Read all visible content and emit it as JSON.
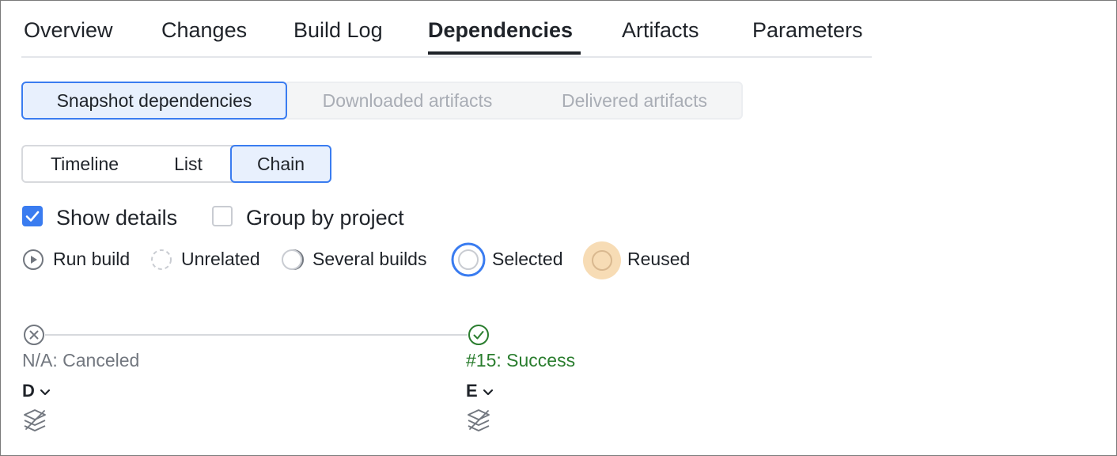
{
  "tabs": [
    {
      "label": "Overview"
    },
    {
      "label": "Changes"
    },
    {
      "label": "Build Log"
    },
    {
      "label": "Dependencies",
      "active": true
    },
    {
      "label": "Artifacts"
    },
    {
      "label": "Parameters"
    }
  ],
  "dependency_types": [
    {
      "label": "Snapshot dependencies",
      "selected": true
    },
    {
      "label": "Downloaded artifacts",
      "disabled": true
    },
    {
      "label": "Delivered artifacts",
      "disabled": true
    }
  ],
  "view_modes": [
    {
      "label": "Timeline"
    },
    {
      "label": "List"
    },
    {
      "label": "Chain",
      "selected": true
    }
  ],
  "options": {
    "show_details": {
      "label": "Show details",
      "checked": true
    },
    "group_by_project": {
      "label": "Group by project",
      "checked": false
    }
  },
  "legend": [
    {
      "label": "Run build",
      "icon": "play-circle-icon"
    },
    {
      "label": "Unrelated",
      "icon": "dashed-circle-icon"
    },
    {
      "label": "Several builds",
      "icon": "stacked-circle-icon"
    },
    {
      "label": "Selected",
      "icon": "selected-ring-icon"
    },
    {
      "label": "Reused",
      "icon": "reused-circle-icon"
    }
  ],
  "chain": [
    {
      "status": "N/A: Canceled",
      "state": "canceled",
      "name": "D",
      "status_color": "#72777f"
    },
    {
      "status": "#15: Success",
      "state": "success",
      "name": "E",
      "status_color": "#2a7d2e"
    }
  ],
  "colors": {
    "accent": "#3a7cf0",
    "success": "#2a7d2e",
    "reused": "#f7dcb5",
    "muted": "#72777f"
  }
}
